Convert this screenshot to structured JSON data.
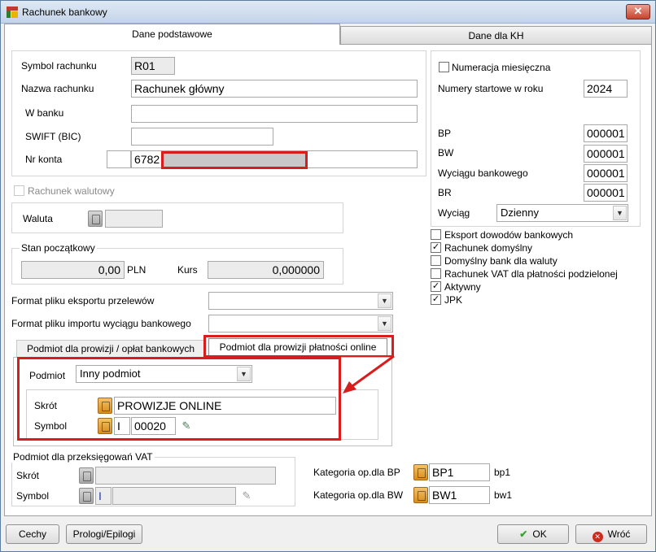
{
  "window": {
    "title": "Rachunek bankowy",
    "close_glyph": "✕"
  },
  "tabs": {
    "active": "Dane podstawowe",
    "inactive": "Dane dla KH"
  },
  "fields": {
    "symbol_label": "Symbol rachunku",
    "symbol_value": "R01",
    "name_label": "Nazwa rachunku",
    "name_value": "Rachunek główny",
    "bank_label": "W banku",
    "bank_value": "",
    "swift_label": "SWIFT (BIC)",
    "swift_value": "",
    "account_label": "Nr konta",
    "account_prefix": "",
    "account_value": "6782"
  },
  "currency_account": {
    "label": "Rachunek walutowy",
    "checked": false
  },
  "currency": {
    "label": "Waluta",
    "value": ""
  },
  "opening_balance": {
    "group": "Stan początkowy",
    "amount": "0,00",
    "currency": "PLN",
    "rate_label": "Kurs",
    "rate": "0,000000"
  },
  "export_format": {
    "label": "Format pliku eksportu przelewów",
    "value": ""
  },
  "import_format": {
    "label": "Format pliku importu wyciągu bankowego",
    "value": ""
  },
  "subtabs": {
    "inactive": "Podmiot dla prowizji / opłat bankowych",
    "active": "Podmiot dla prowizji płatności online"
  },
  "commission": {
    "entity_label": "Podmiot",
    "entity_value": "Inny podmiot",
    "short_label": "Skrót",
    "short_value": "PROWIZJE ONLINE",
    "symbol_label": "Symbol",
    "symbol_type": "I",
    "symbol_value": "00020"
  },
  "vat_entity": {
    "group": "Podmiot dla przeksięgowań VAT",
    "short_label": "Skrót",
    "short_value": "",
    "symbol_label": "Symbol",
    "symbol_type": "I",
    "symbol_value": ""
  },
  "categories": {
    "bp_label": "Kategoria op.dla BP",
    "bp_value": "BP1",
    "bp_desc": "bp1",
    "bw_label": "Kategoria op.dla BW",
    "bw_value": "BW1",
    "bw_desc": "bw1"
  },
  "numbering": {
    "monthly_label": "Numeracja miesięczna",
    "monthly_checked": false,
    "start_label": "Numery startowe w roku",
    "year": "2024",
    "bp_label": "BP",
    "bp_value": "000001",
    "bw_label": "BW",
    "bw_value": "000001",
    "statement_label": "Wyciągu bankowego",
    "statement_value": "000001",
    "br_label": "BR",
    "br_value": "000001",
    "extract_label": "Wyciąg",
    "extract_value": "Dzienny"
  },
  "options": [
    {
      "label": "Eksport dowodów bankowych",
      "checked": false
    },
    {
      "label": "Rachunek domyślny",
      "checked": true
    },
    {
      "label": "Domyślny bank dla waluty",
      "checked": false
    },
    {
      "label": "Rachunek VAT dla płatności podzielonej",
      "checked": false
    },
    {
      "label": "Aktywny",
      "checked": true
    },
    {
      "label": "JPK",
      "checked": true
    }
  ],
  "footer": {
    "cechy": "Cechy",
    "prologi": "Prologi/Epilogi",
    "ok": "OK",
    "cancel": "Wróć"
  },
  "colors": {
    "highlight": "#d91c1c",
    "ok_icon": "#3aa335",
    "cancel_icon": "#cc2b1e"
  }
}
